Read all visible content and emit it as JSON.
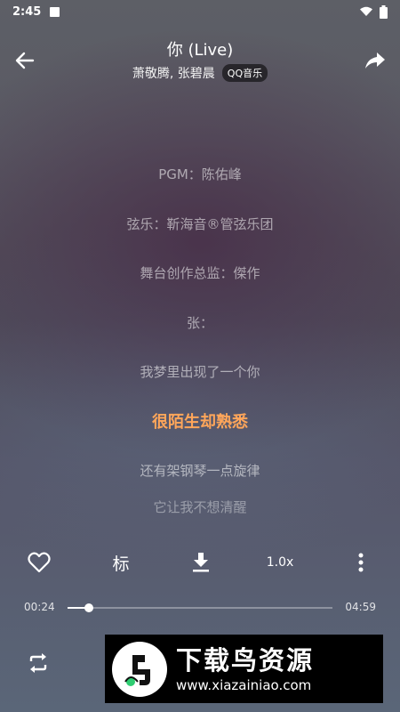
{
  "status_bar": {
    "time": "2:45"
  },
  "header": {
    "title": "你 (Live)",
    "artists": "萧敬腾, 张碧晨",
    "source_badge": "QQ音乐"
  },
  "lyrics": [
    {
      "text": "PGM：陈佑峰",
      "state": "normal"
    },
    {
      "text": "弦乐：靳海音®管弦乐团",
      "state": "normal"
    },
    {
      "text": "舞台创作总监：傑作",
      "state": "normal"
    },
    {
      "text": "张：",
      "state": "normal"
    },
    {
      "text": "我梦里出现了一个你",
      "state": "normal"
    },
    {
      "text": "很陌生却熟悉",
      "state": "active"
    },
    {
      "text": "还有架钢琴一点旋律",
      "state": "normal"
    },
    {
      "text": "它让我不想清醒",
      "state": "partial"
    }
  ],
  "controls": {
    "mark_label": "标",
    "speed_label": "1.0x"
  },
  "playback": {
    "current_time": "00:24",
    "total_time": "04:59",
    "progress": 0.08
  },
  "watermark": {
    "title": "下载鸟资源",
    "url": "www.xiazainiao.com"
  },
  "colors": {
    "active_lyric": "#ffa65a",
    "text": "#ffffff"
  }
}
